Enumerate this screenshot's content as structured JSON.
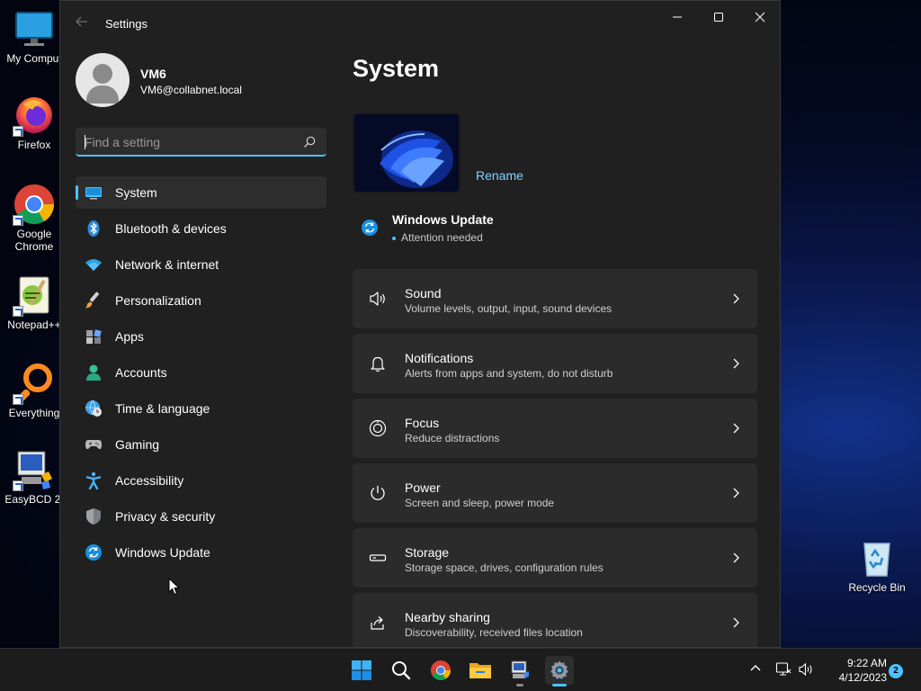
{
  "desktop": {
    "icons": [
      {
        "label": "My Comput",
        "icon": "monitor-icon"
      },
      {
        "label": "Firefox",
        "icon": "firefox-icon"
      },
      {
        "label": "Google Chrome",
        "icon": "chrome-icon"
      },
      {
        "label": "Notepad++",
        "icon": "notepad-icon"
      },
      {
        "label": "Everything",
        "icon": "everything-icon"
      },
      {
        "label": "EasyBCD 2.",
        "icon": "easybcd-icon"
      }
    ],
    "recycle_bin": {
      "label": "Recycle Bin",
      "icon": "recycle-bin-icon"
    }
  },
  "window": {
    "title": "Settings",
    "controls": [
      "minimize",
      "maximize",
      "close"
    ]
  },
  "profile": {
    "name": "VM6",
    "email": "VM6@collabnet.local"
  },
  "search": {
    "placeholder": "Find a setting",
    "value": ""
  },
  "sidebar": {
    "items": [
      {
        "label": "System",
        "icon": "system-monitor-icon",
        "active": true
      },
      {
        "label": "Bluetooth & devices",
        "icon": "bluetooth-icon"
      },
      {
        "label": "Network & internet",
        "icon": "wifi-icon"
      },
      {
        "label": "Personalization",
        "icon": "brush-icon"
      },
      {
        "label": "Apps",
        "icon": "apps-icon"
      },
      {
        "label": "Accounts",
        "icon": "person-icon"
      },
      {
        "label": "Time & language",
        "icon": "globe-clock-icon"
      },
      {
        "label": "Gaming",
        "icon": "gamepad-icon"
      },
      {
        "label": "Accessibility",
        "icon": "accessibility-icon"
      },
      {
        "label": "Privacy & security",
        "icon": "shield-icon"
      },
      {
        "label": "Windows Update",
        "icon": "update-icon"
      }
    ]
  },
  "main": {
    "title": "System",
    "rename_label": "Rename",
    "windows_update": {
      "title": "Windows Update",
      "status": "Attention needed"
    },
    "cards": [
      {
        "title": "Sound",
        "desc": "Volume levels, output, input, sound devices",
        "icon": "speaker-icon"
      },
      {
        "title": "Notifications",
        "desc": "Alerts from apps and system, do not disturb",
        "icon": "bell-icon"
      },
      {
        "title": "Focus",
        "desc": "Reduce distractions",
        "icon": "focus-icon"
      },
      {
        "title": "Power",
        "desc": "Screen and sleep, power mode",
        "icon": "power-icon"
      },
      {
        "title": "Storage",
        "desc": "Storage space, drives, configuration rules",
        "icon": "storage-icon"
      },
      {
        "title": "Nearby sharing",
        "desc": "Discoverability, received files location",
        "icon": "share-icon"
      }
    ]
  },
  "taskbar": {
    "apps": [
      "start-icon",
      "search-icon",
      "chrome-icon",
      "file-explorer-icon",
      "remote-desktop-icon",
      "settings-icon"
    ],
    "time": "9:22 AM",
    "date": "4/12/2023",
    "notification_count": "2"
  },
  "colors": {
    "accent": "#4cc2ff",
    "window_bg": "#202020",
    "card_bg": "#2b2b2b",
    "taskbar_bg": "#1c1c1c"
  }
}
